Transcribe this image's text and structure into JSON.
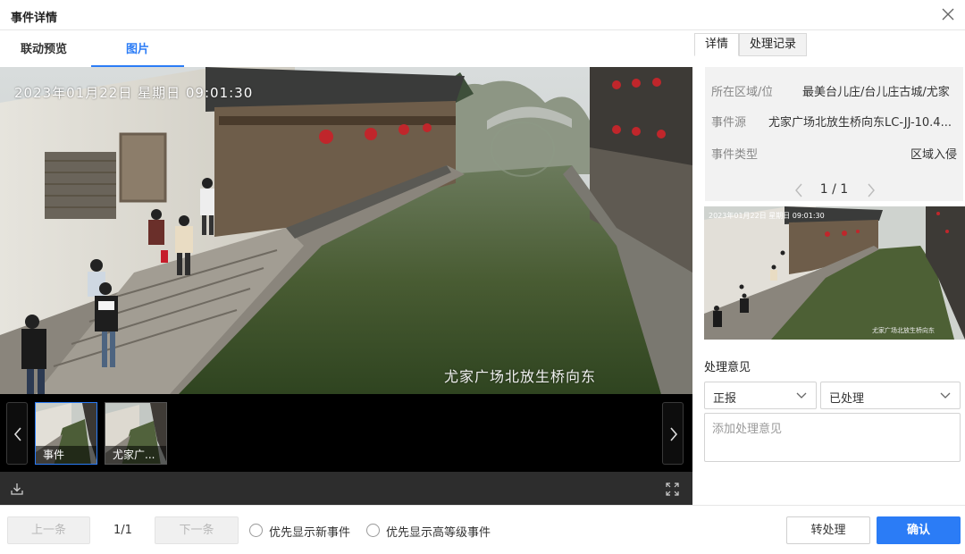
{
  "window": {
    "title": "事件详情",
    "close_icon": "close-icon"
  },
  "left_tabs": [
    {
      "label": "联动预览",
      "active": false
    },
    {
      "label": "图片",
      "active": true
    }
  ],
  "viewer": {
    "timestamp": "2023年01月22日  星期日  09:01:30",
    "camera_label": "尤家广场北放生桥向东"
  },
  "filmstrip": {
    "thumbnails": [
      {
        "caption": "事件",
        "selected": true
      },
      {
        "caption": "尤家广...",
        "selected": false
      }
    ]
  },
  "right_tabs": [
    {
      "label": "详情",
      "active": true
    },
    {
      "label": "处理记录",
      "active": false
    }
  ],
  "details": {
    "rows": [
      {
        "label": "所在区域/位",
        "value": "最美台儿庄/台儿庄古城/尤家"
      },
      {
        "label": "事件源",
        "value": "尤家广场北放生桥向东LC-JJ-10.4..."
      },
      {
        "label": "事件类型",
        "value": "区域入侵"
      }
    ],
    "pager": "1 / 1"
  },
  "right_thumbnail": {
    "timestamp": "2023年01月22日  星期日  09:01:30",
    "camera_label": "尤家广场北放生桥向东"
  },
  "opinion": {
    "label": "处理意见",
    "report_select": "正报",
    "status_select": "已处理",
    "placeholder": "添加处理意见"
  },
  "footer": {
    "prev_label": "上一条",
    "count": "1/1",
    "next_label": "下一条",
    "radio_new": "优先显示新事件",
    "radio_level": "优先显示高等级事件",
    "transfer_label": "转处理",
    "confirm_label": "确认"
  },
  "colors": {
    "accent": "#2b7cf6",
    "panel_bg": "#f2f2f2",
    "filmstrip_bg": "#000000",
    "toolbar_bg": "#2d2d2d"
  }
}
